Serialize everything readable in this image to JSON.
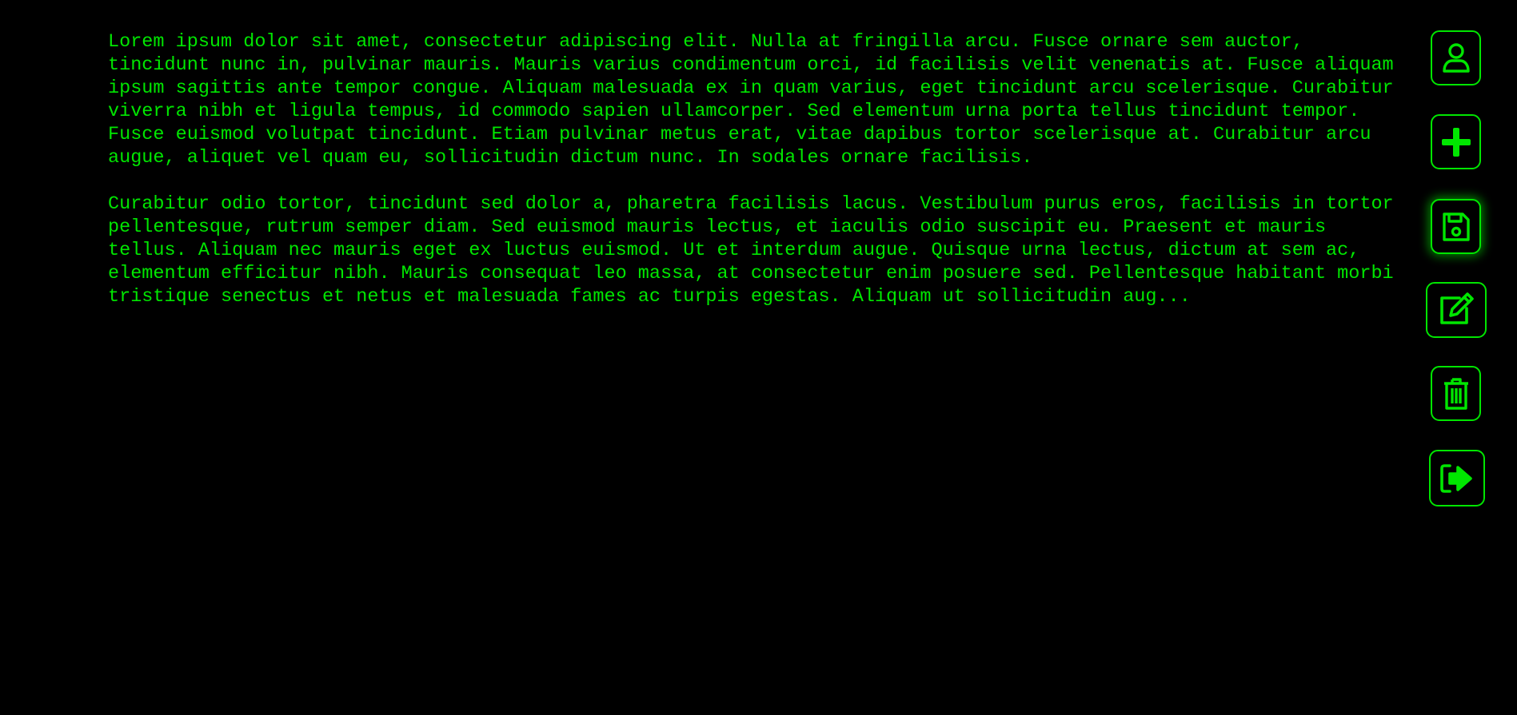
{
  "editor": {
    "paragraphs": [
      "Lorem ipsum dolor sit amet, consectetur adipiscing elit. Nulla at fringilla arcu. Fusce ornare sem auctor, tincidunt nunc in, pulvinar mauris. Mauris varius condimentum orci, id facilisis velit venenatis at. Fusce aliquam ipsum sagittis ante tempor congue. Aliquam malesuada ex in quam varius, eget tincidunt arcu scelerisque. Curabitur viverra nibh et ligula tempus, id commodo sapien ullamcorper. Sed elementum urna porta tellus tincidunt tempor. Fusce euismod volutpat tincidunt. Etiam pulvinar metus erat, vitae dapibus tortor scelerisque at. Curabitur arcu augue, aliquet vel quam eu, sollicitudin dictum nunc. In sodales ornare facilisis.",
      "Curabitur odio tortor, tincidunt sed dolor a, pharetra facilisis lacus. Vestibulum purus eros, facilisis in tortor pellentesque, rutrum semper diam. Sed euismod mauris lectus, et iaculis odio suscipit eu. Praesent et mauris tellus. Aliquam nec mauris eget ex luctus euismod. Ut et interdum augue. Quisque urna lectus, dictum at sem ac, elementum efficitur nibh. Mauris consequat leo massa, at consectetur enim posuere sed. Pellentesque habitant morbi tristique senectus et netus et malesuada fames ac turpis egestas. Aliquam ut sollicitudin aug..."
    ]
  },
  "toolbar": {
    "buttons": [
      {
        "icon": "user-icon",
        "active": false
      },
      {
        "icon": "plus-icon",
        "active": false
      },
      {
        "icon": "save-icon",
        "active": true
      },
      {
        "icon": "edit-icon",
        "active": false
      },
      {
        "icon": "trash-icon",
        "active": false
      },
      {
        "icon": "sign-out-icon",
        "active": false
      }
    ]
  },
  "colors": {
    "background": "#000000",
    "accent": "#00e600"
  }
}
